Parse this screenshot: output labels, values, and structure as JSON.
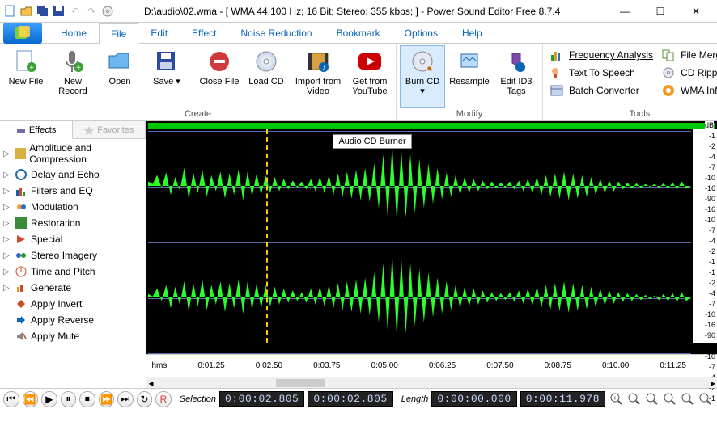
{
  "title": "D:\\audio\\02.wma - [ WMA 44,100 Hz; 16 Bit; Stereo; 355 kbps; ] - Power Sound Editor Free 8.7.4",
  "menus": {
    "home": "Home",
    "file": "File",
    "edit": "Edit",
    "effect": "Effect",
    "noise": "Noise Reduction",
    "bookmark": "Bookmark",
    "options": "Options",
    "help": "Help"
  },
  "ribbon": {
    "create": {
      "title": "Create",
      "new_file": "New\nFile",
      "new_record": "New\nRecord",
      "open": "Open",
      "save": "Save",
      "close_file": "Close\nFile",
      "load_cd": "Load\nCD",
      "import_video": "Import\nfrom Video",
      "get_youtube": "Get from\nYouTube"
    },
    "modify": {
      "title": "Modify",
      "burn_cd": "Burn\nCD",
      "resample": "Resample",
      "edit_id3": "Edit ID3\nTags"
    },
    "tools": {
      "title": "Tools",
      "freq": "Frequency Analysis",
      "tts": "Text To Speech",
      "batch": "Batch Converter",
      "file_merger": "File Merger",
      "cd_ripper": "CD Ripper",
      "wma_info": "WMA Info"
    }
  },
  "tooltip": "Audio CD Burner",
  "sidebar": {
    "tab_effects": "Effects",
    "tab_favorites": "Favorites",
    "items": [
      "Amplitude and Compression",
      "Delay and Echo",
      "Filters and EQ",
      "Modulation",
      "Restoration",
      "Special",
      "Stereo Imagery",
      "Time and Pitch",
      "Generate",
      "Apply Invert",
      "Apply Reverse",
      "Apply Mute"
    ]
  },
  "db_labels": [
    "-1",
    "-2",
    "-4",
    "-7",
    "-10",
    "-16",
    "-90",
    "-16",
    "-10",
    "-7",
    "-4",
    "-2",
    "-1"
  ],
  "db_unit": "dB",
  "timeaxis": {
    "unit": "hms",
    "ticks": [
      "0:01.25",
      "0:02.50",
      "0:03.75",
      "0:05.00",
      "0:06.25",
      "0:07.50",
      "0:08.75",
      "0:10.00",
      "0:11.25"
    ]
  },
  "status": {
    "selection_label": "Selection",
    "selection_start": "0:00:02.805",
    "selection_end": "0:00:02.805",
    "length_label": "Length",
    "length_start": "0:00:00.000",
    "length_total": "0:00:11.978"
  }
}
